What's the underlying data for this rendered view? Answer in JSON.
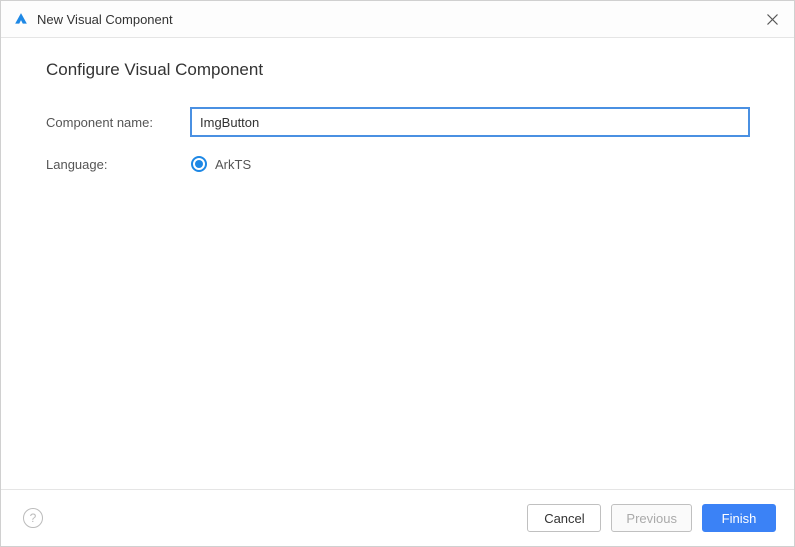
{
  "window": {
    "title": "New Visual Component"
  },
  "heading": "Configure Visual Component",
  "form": {
    "name_label": "Component name:",
    "name_value": "ImgButton",
    "language_label": "Language:",
    "language_option": "ArkTS"
  },
  "footer": {
    "help_tooltip": "Help",
    "cancel": "Cancel",
    "previous": "Previous",
    "finish": "Finish"
  },
  "colors": {
    "accent": "#3b82f6",
    "radio": "#1e88e5",
    "input_border": "#4a90e2"
  }
}
